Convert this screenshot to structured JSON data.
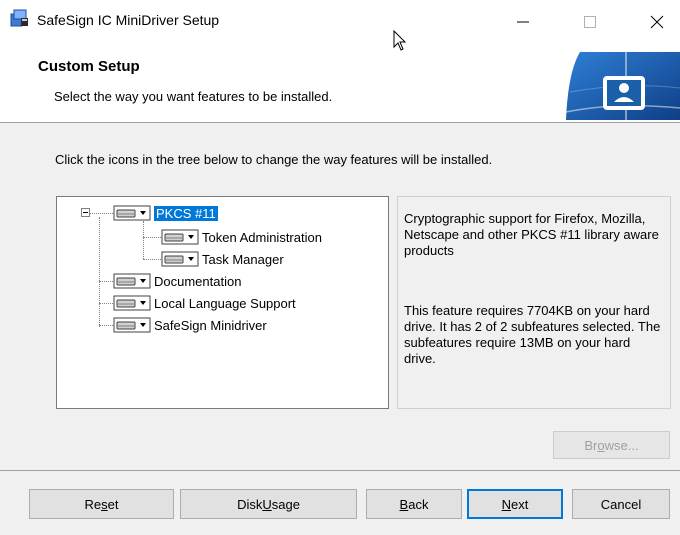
{
  "window": {
    "title": "SafeSign IC MiniDriver Setup",
    "minimize_glyph": "—",
    "maximize_glyph": "☐",
    "close_glyph": "✕"
  },
  "header": {
    "title": "Custom Setup",
    "subtitle": "Select the way you want features to be installed."
  },
  "instruction": "Click the icons in the tree below to change the way features will be installed.",
  "tree": {
    "items": [
      {
        "label": "PKCS #11",
        "selected": true
      },
      {
        "label": "Token Administration"
      },
      {
        "label": "Task Manager"
      },
      {
        "label": "Documentation"
      },
      {
        "label": "Local Language Support"
      },
      {
        "label": "SafeSign Minidriver"
      }
    ]
  },
  "description": {
    "text": "Cryptographic support for Firefox, Mozilla, Netscape and other PKCS #11 library aware products",
    "requirements": "This feature requires 7704KB on your hard drive. It has 2 of 2 subfeatures selected. The subfeatures require 13MB on your hard drive."
  },
  "browse": {
    "pre": "Br",
    "key": "o",
    "post": "wse..."
  },
  "buttons": {
    "reset": {
      "pre": "Re",
      "key": "s",
      "post": "et"
    },
    "disk_usage": {
      "pre": "Disk ",
      "key": "U",
      "post": "sage"
    },
    "back": {
      "pre": "",
      "key": "B",
      "post": "ack"
    },
    "next": {
      "pre": "",
      "key": "N",
      "post": "ext"
    },
    "cancel": "Cancel"
  },
  "colors": {
    "selection": "#0078d7",
    "logo_blue": "#1a5fa8"
  }
}
